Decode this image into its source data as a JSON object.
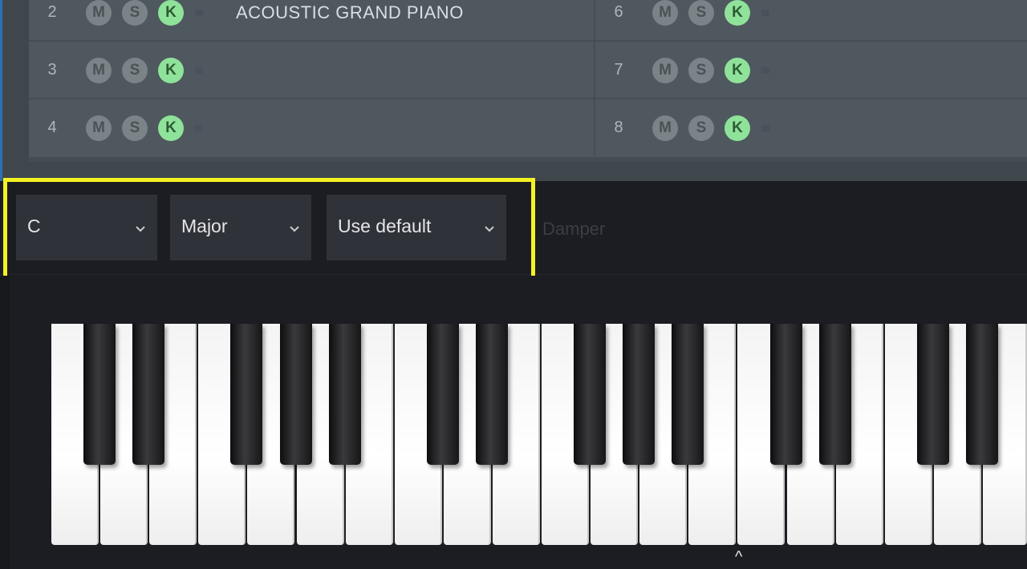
{
  "channel_rack": {
    "rows": [
      {
        "number": "2",
        "name": "ACOUSTIC GRAND PIANO"
      },
      {
        "number": "3",
        "name": ""
      },
      {
        "number": "4",
        "name": ""
      },
      {
        "number": "6",
        "name": ""
      },
      {
        "number": "7",
        "name": ""
      },
      {
        "number": "8",
        "name": ""
      }
    ],
    "buttons": {
      "mute": "M",
      "solo": "S",
      "keyboard": "K"
    }
  },
  "toolbar": {
    "key_value": "C",
    "scale_value": "Major",
    "velocity_value": "Use default",
    "damper_label": "Damper"
  },
  "keyboard": {
    "octave_marker": "^"
  },
  "colors": {
    "highlight": "#f3f222",
    "k_button": "#8fe29a",
    "rack_bg": "#4f585e"
  }
}
